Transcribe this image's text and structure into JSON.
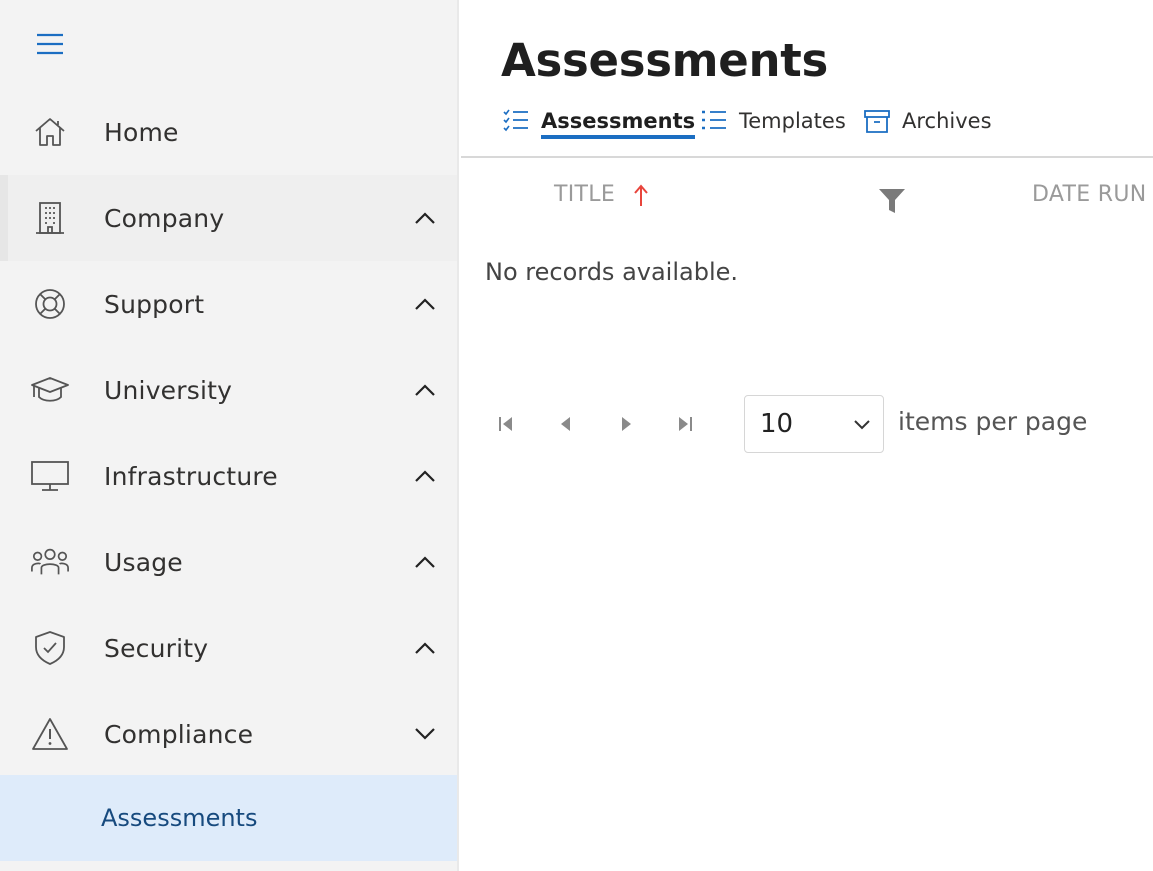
{
  "sidebar": {
    "items": [
      {
        "label": "Home",
        "icon": "home-icon"
      },
      {
        "label": "Company",
        "icon": "building-icon"
      },
      {
        "label": "Support",
        "icon": "lifebuoy-icon"
      },
      {
        "label": "University",
        "icon": "graduation-cap-icon"
      },
      {
        "label": "Infrastructure",
        "icon": "monitor-icon"
      },
      {
        "label": "Usage",
        "icon": "users-icon"
      },
      {
        "label": "Security",
        "icon": "shield-check-icon"
      },
      {
        "label": "Compliance",
        "icon": "warning-icon"
      }
    ],
    "sub_items": [
      {
        "label": "Assessments"
      }
    ]
  },
  "main": {
    "title": "Assessments",
    "tabs": [
      {
        "label": "Assessments",
        "icon": "checklist-icon",
        "selected": true
      },
      {
        "label": "Templates",
        "icon": "list-icon",
        "selected": false
      },
      {
        "label": "Archives",
        "icon": "archive-icon",
        "selected": false
      }
    ],
    "grid": {
      "columns": [
        "TITLE",
        "DATE RUN"
      ],
      "empty_message": "No records available."
    },
    "pager": {
      "page_size": "10",
      "items_per_page_label": "items per page"
    }
  },
  "colors": {
    "accent": "#1b6ec2",
    "sort_arrow": "#e8453c",
    "active_sub_bg": "#deebfa"
  }
}
